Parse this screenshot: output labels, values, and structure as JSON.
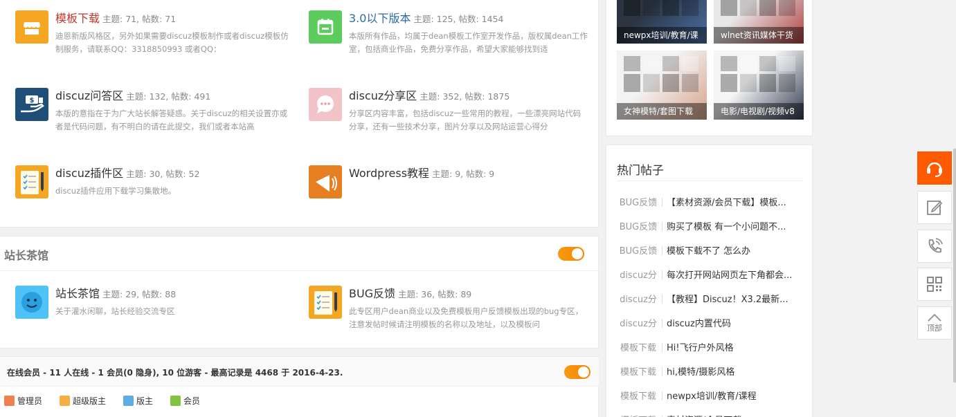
{
  "forums_top": [
    {
      "name": "模板下载",
      "stat": "主题: 71, 帖数: 71",
      "desc": "迪恩新版风格区，另外如果需要discuz模板制作或者discuz模板仿制服务，请联系QQ：3318850993 或者QQ：",
      "color": "#f5a623",
      "icon": "store-icon",
      "style": "red"
    },
    {
      "name": "3.0以下版本",
      "stat": "主题: 125, 帖数: 1454",
      "desc": "本版所有作品，均属于dean模板工作室开发作品，版权属dean工作室，包括商业作品，免费分享作品，希望大家能够找到适",
      "color": "#5ccc5c",
      "icon": "calendar-icon",
      "style": "blue"
    },
    {
      "name": "discuz问答区",
      "stat": "主题: 132, 帖数: 491",
      "desc": "本版的意指在于为广大站长解答疑惑。关于discuz的相关设置亦或者是代码问题，有不明白的请在此提交，我们或者本站高",
      "color": "#1f4e79",
      "icon": "money-hand-icon",
      "style": ""
    },
    {
      "name": "discuz分享区",
      "stat": "主题: 352, 帖数: 1875",
      "desc": "分享区内容丰富，包括discuz一些常用的教程，一些漂亮网站代码分享，还有一些技术分享，图片分享以及网站运营心得分",
      "color": "#f2c4c8",
      "icon": "chat-bubble-icon",
      "style": ""
    },
    {
      "name": "discuz插件区",
      "stat": "主题: 30, 帖数: 52",
      "desc": "discuz插件应用下载学习集散地。",
      "color": "#f5a623",
      "icon": "checklist-icon",
      "style": ""
    },
    {
      "name": "Wordpress教程",
      "stat": "主题: 9, 帖数: 9",
      "desc": "",
      "color": "#e67e22",
      "icon": "megaphone-icon",
      "style": ""
    }
  ],
  "section2": {
    "title": "站长茶馆",
    "forums": [
      {
        "name": "站长茶馆",
        "stat": "主题: 29, 帖数: 88",
        "desc": "关于灌水闲聊，站长经验交流专区",
        "color": "#4fc3f7",
        "icon": "smiley-icon",
        "style": ""
      },
      {
        "name": "BUG反馈",
        "stat": "主题: 36, 帖数: 89",
        "desc": "此专区用户dean商业以及免费模板用户反馈模板出现的bug专区，注意发帖时候请注明模板的名称以及地址，以及模板问",
        "color": "#f5a623",
        "icon": "checklist-icon",
        "style": ""
      }
    ]
  },
  "online": {
    "text": "在线会员 - 11 人在线 - 1 会员(0 隐身), 10 位游客 - 最高记录是 4468 于 2016-4-23.",
    "legend": [
      {
        "label": "管理员",
        "color": "#f08050"
      },
      {
        "label": "超级版主",
        "color": "#f5b041"
      },
      {
        "label": "版主",
        "color": "#5dade2"
      },
      {
        "label": "会员",
        "color": "#82c341"
      }
    ]
  },
  "side_thumbs": [
    {
      "caption": "newpx培训/教育/课"
    },
    {
      "caption": "wlnet资讯媒体干货"
    },
    {
      "caption": "女神模特/套图下载"
    },
    {
      "caption": "电影/电视剧/视频v8"
    }
  ],
  "hot": {
    "title": "热门帖子",
    "items": [
      {
        "cat": "BUG反馈",
        "title": "【素材资源/会员下载】模板..."
      },
      {
        "cat": "BUG反馈",
        "title": "购买了模板 有一个小问题不..."
      },
      {
        "cat": "BUG反馈",
        "title": "模板下载不了 怎么办"
      },
      {
        "cat": "discuz分",
        "title": "每次打开网站网页左下角都会..."
      },
      {
        "cat": "discuz分",
        "title": "【教程】Discuz！X3.2最新..."
      },
      {
        "cat": "discuz分",
        "title": "discuz内置代码"
      },
      {
        "cat": "模板下载",
        "title": "Hi!飞行户外风格"
      },
      {
        "cat": "模板下载",
        "title": "hi,模特/摄影风格"
      },
      {
        "cat": "模板下载",
        "title": "newpx培训/教育/课程"
      },
      {
        "cat": "模板下载",
        "title": "素材资源/会员下载"
      }
    ]
  },
  "toolbar": {
    "top_label": "顶部"
  },
  "accent": "#ff5a00"
}
